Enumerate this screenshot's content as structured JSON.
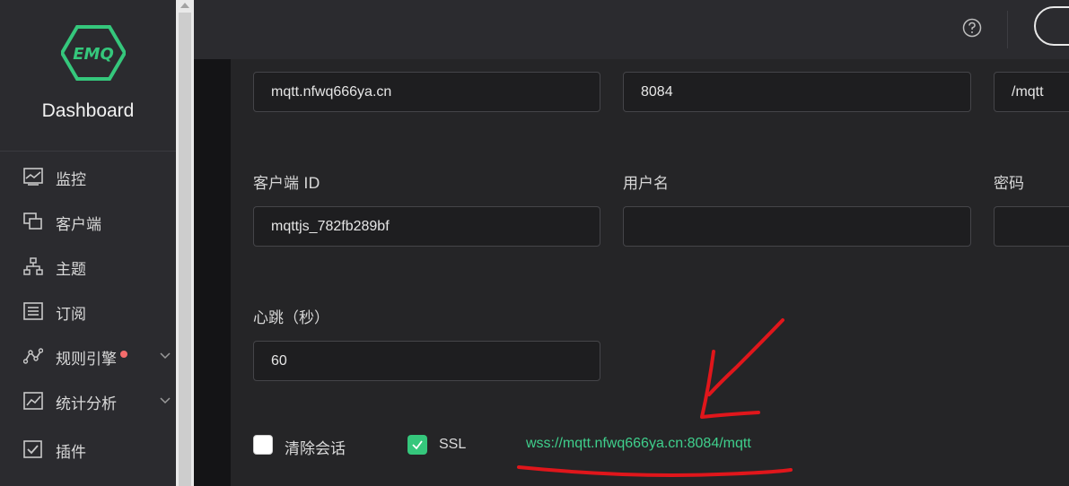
{
  "app": {
    "brand": "Dashboard",
    "logo_text": "EMQ",
    "accent_color": "#35c77c"
  },
  "sidebar": {
    "items": [
      {
        "label": "监控",
        "icon": "monitor-icon"
      },
      {
        "label": "客户端",
        "icon": "clients-icon"
      },
      {
        "label": "主题",
        "icon": "topics-icon"
      },
      {
        "label": "订阅",
        "icon": "subscriptions-icon"
      },
      {
        "label": "规则引擎",
        "icon": "rule-engine-icon",
        "has_dot": true,
        "expandable": true
      },
      {
        "label": "统计分析",
        "icon": "analytics-icon",
        "expandable": true
      },
      {
        "label": "插件",
        "icon": "plugins-icon"
      }
    ]
  },
  "header": {
    "help_icon": "help-circle-icon"
  },
  "form": {
    "host_value": "mqtt.nfwq666ya.cn",
    "port_value": "8084",
    "path_value": "/mqtt",
    "client_id_label": "客户端 ID",
    "client_id_value": "mqttjs_782fb289bf",
    "username_label": "用户名",
    "username_value": "",
    "password_label": "密码",
    "password_value": "",
    "keepalive_label": "心跳（秒）",
    "keepalive_value": "60",
    "clean_session_label": "清除会话",
    "clean_session_checked": false,
    "ssl_label": "SSL",
    "ssl_checked": true,
    "connection_url": "wss://mqtt.nfwq666ya.cn:8084/mqtt"
  },
  "annotation": {
    "color": "#e0161b",
    "shapes": [
      "arrow-icon",
      "underline"
    ]
  }
}
